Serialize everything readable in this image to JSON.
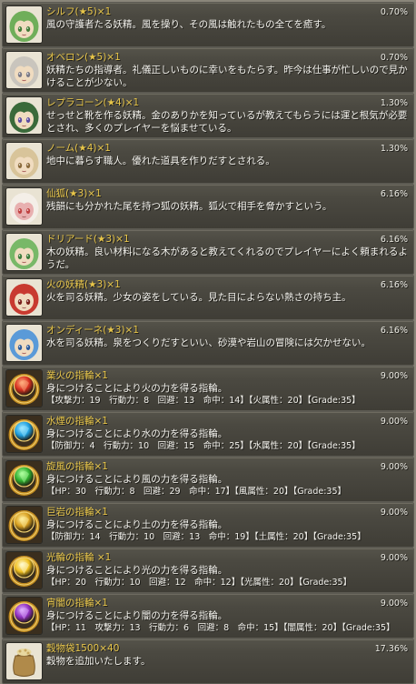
{
  "items": [
    {
      "id": "sylph",
      "title": "シルフ(★5)×1",
      "rate": "0.70%",
      "desc": "風の守護者たる妖精。風を操り、その風は触れたもの全てを癒す。",
      "icon": "fairy-green-hair-icon",
      "colors": [
        "#6fae5a",
        "#f0dcc0",
        "#3f7a35"
      ]
    },
    {
      "id": "oberon",
      "title": "オベロン(★5)×1",
      "rate": "0.70%",
      "desc": "妖精たちの指導者。礼儀正しいものに幸いをもたらす。昨今は仕事が忙しいので見かけることが少ない。",
      "icon": "fairy-king-silver-hair-icon",
      "colors": [
        "#c9c5bd",
        "#f0dcc0",
        "#7a7a86"
      ]
    },
    {
      "id": "leprechaun",
      "title": "レプラコーン(★4)×1",
      "rate": "1.30%",
      "desc": "せっせと靴を作る妖精。金のありかを知っているが教えてもらうには運と根気が必要とされ、多くのプレイヤーを悩ませている。",
      "icon": "fairy-leprechaun-icon",
      "colors": [
        "#3a6a3a",
        "#f0dcc0",
        "#5a4aa0"
      ]
    },
    {
      "id": "gnome",
      "title": "ノーム(★4)×1",
      "rate": "1.30%",
      "desc": "地中に暮らす職人。優れた道具を作りだすとされる。",
      "icon": "fairy-gnome-icon",
      "colors": [
        "#d8c49a",
        "#f0dcc0",
        "#8a6a3a"
      ]
    },
    {
      "id": "senko",
      "title": "仙狐(★3)×1",
      "rate": "6.16%",
      "desc": "残韻にも分かれた尾を持つ狐の妖精。狐火で相手を脅かすという。",
      "icon": "fox-spirit-mask-icon",
      "colors": [
        "#f4efe8",
        "#e8b0b0",
        "#c04040"
      ]
    },
    {
      "id": "dryad",
      "title": "ドリアード(★3)×1",
      "rate": "6.16%",
      "desc": "木の妖精。良い材料になる木があると教えてくれるのでプレイヤーによく頼まれるようだ。",
      "icon": "fairy-dryad-icon",
      "colors": [
        "#78b868",
        "#f0dcc0",
        "#3a7a3a"
      ]
    },
    {
      "id": "fire-fairy",
      "title": "火の妖精(★3)×1",
      "rate": "6.16%",
      "desc": "火を司る妖精。少女の姿をしている。見た目によらない熱さの持ち主。",
      "icon": "fairy-fire-red-hair-icon",
      "colors": [
        "#c83a30",
        "#f0dcc0",
        "#7a1f1a"
      ]
    },
    {
      "id": "undine",
      "title": "オンディーネ(★3)×1",
      "rate": "6.16%",
      "desc": "水を司る妖精。泉をつくりだすといい、砂漠や岩山の冒険には欠かせない。",
      "icon": "fairy-undine-blue-hair-icon",
      "colors": [
        "#5a9ad8",
        "#f0dcc0",
        "#2a5a9a"
      ]
    },
    {
      "id": "ring-fire",
      "title": "業火の指輪×1",
      "rate": "9.00%",
      "desc": "身につけることにより火の力を得る指輪。",
      "stats": "【攻撃力：19　行動力：8　回避：13　命中：14】【火属性：20】【Grade:35】",
      "icon": "ring-fire-red-gem-icon",
      "colors": [
        "#d83020",
        "#c08a20",
        "#ffb080"
      ]
    },
    {
      "id": "ring-water",
      "title": "水煙の指輪×1",
      "rate": "9.00%",
      "desc": "身につけることにより水の力を得る指輪。",
      "stats": "【防御力：4　行動力：10　回避：15　命中：25】【水属性：20】【Grade:35】",
      "icon": "ring-water-blue-gem-icon",
      "colors": [
        "#20a0e0",
        "#c08a20",
        "#a0e8ff"
      ]
    },
    {
      "id": "ring-wind",
      "title": "旋風の指輪×1",
      "rate": "9.00%",
      "desc": "身につけることにより風の力を得る指輪。",
      "stats": "【HP：30　行動力：8　回避：29　命中：17】【風属性：20】【Grade:35】",
      "icon": "ring-wind-green-gem-icon",
      "colors": [
        "#30b030",
        "#c08a20",
        "#b0ffa0"
      ]
    },
    {
      "id": "ring-earth",
      "title": "巨岩の指輪×1",
      "rate": "9.00%",
      "desc": "身につけることにより土の力を得る指輪。",
      "stats": "【防御力：14　行動力：10　回避：13　命中：19】【土属性：20】【Grade:35】",
      "icon": "ring-earth-yellow-gem-icon",
      "colors": [
        "#d8a020",
        "#c08a20",
        "#fff0a0"
      ]
    },
    {
      "id": "ring-light",
      "title": "光輪の指輪 ×1",
      "rate": "9.00%",
      "desc": "身につけることにより光の力を得る指輪。",
      "stats": "【HP：20　行動力：10　回避：12　命中：12】【光属性：20】【Grade:35】",
      "icon": "ring-light-gold-gem-icon",
      "colors": [
        "#f0c020",
        "#c08a20",
        "#fffbd0"
      ]
    },
    {
      "id": "ring-dark",
      "title": "宵闇の指輪×1",
      "rate": "9.00%",
      "desc": "身につけることにより闇の力を得る指輪。",
      "stats": "【HP：11　攻撃力：13　行動力：6　回避：8　命中：15】【闇属性：20】【Grade:35】",
      "icon": "ring-dark-purple-gem-icon",
      "colors": [
        "#9030c0",
        "#c08a20",
        "#e0b0ff"
      ]
    },
    {
      "id": "grain-bag",
      "title": "穀物袋1500×40",
      "rate": "17.36%",
      "desc": "穀物を追加いたします。",
      "icon": "grain-sack-icon",
      "colors": [
        "#b08a4a",
        "#7a5a2a",
        "#e8d8a0"
      ]
    }
  ]
}
